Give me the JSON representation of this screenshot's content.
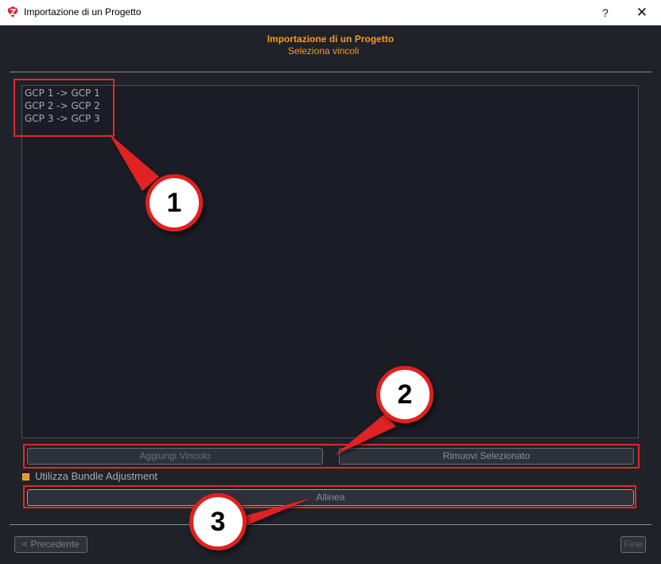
{
  "window": {
    "title": "Importazione di un Progetto",
    "help_label": "?",
    "close_label": "✕"
  },
  "header": {
    "title": "Importazione di un Progetto",
    "subtitle": "Seleziona vincoli"
  },
  "constraints": {
    "items": [
      "GCP 1 -> GCP 1",
      "GCP 2 -> GCP 2",
      "GCP 3 -> GCP 3"
    ]
  },
  "actions": {
    "add_label": "Aggiungi Vincolo",
    "remove_label": "Rimuovi Selezionato",
    "bundle_label": "Utilizza Bundle Adjustment",
    "bundle_checked": true,
    "align_label": "Allinea"
  },
  "nav": {
    "prev_label": "< Precedente",
    "finish_label": "Fine"
  },
  "annotations": {
    "callout_1": "1",
    "callout_2": "2",
    "callout_3": "3",
    "highlight_color": "#e02a2a"
  },
  "colors": {
    "accent": "#f39a1e",
    "background": "#1f2229",
    "list_background": "#1a1d25"
  }
}
